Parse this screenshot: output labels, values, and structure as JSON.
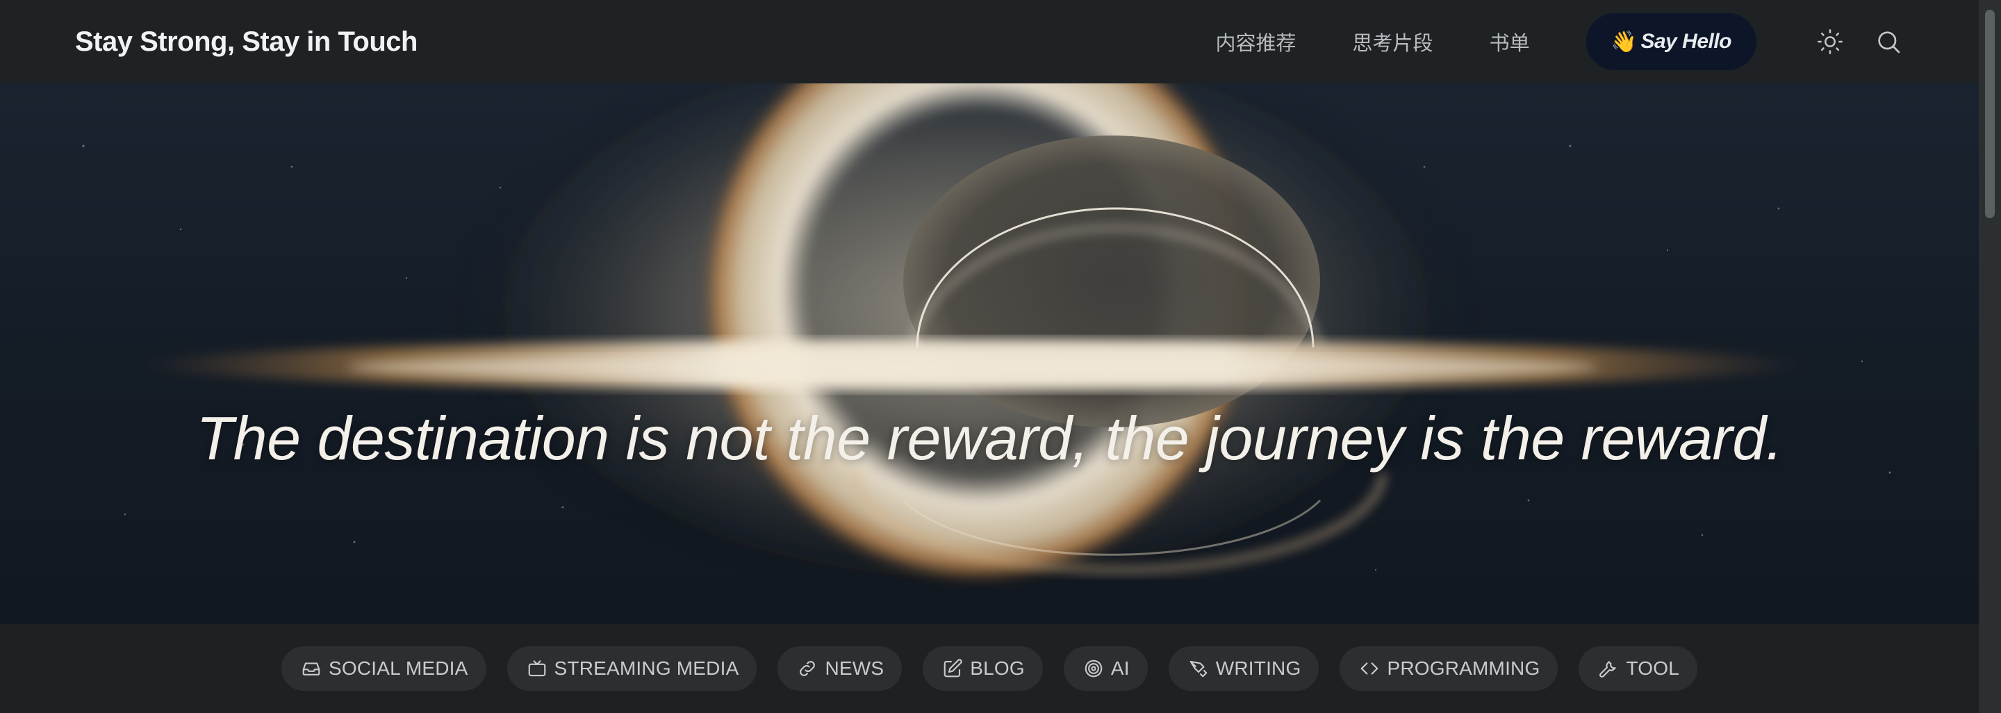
{
  "header": {
    "site_title": "Stay Strong, Stay in Touch",
    "nav": [
      {
        "label": "内容推荐"
      },
      {
        "label": "思考片段"
      },
      {
        "label": "书单"
      }
    ],
    "cta": {
      "emoji": "👋",
      "label": "Say Hello"
    },
    "icons": {
      "theme": "sun-icon",
      "search": "search-icon"
    }
  },
  "hero": {
    "quote": "The destination is not the reward, the journey is the reward."
  },
  "categories": [
    {
      "label": "SOCIAL MEDIA",
      "icon": "inbox-icon"
    },
    {
      "label": "STREAMING MEDIA",
      "icon": "tv-icon"
    },
    {
      "label": "NEWS",
      "icon": "link-icon"
    },
    {
      "label": "BLOG",
      "icon": "edit-icon"
    },
    {
      "label": "AI",
      "icon": "target-icon"
    },
    {
      "label": "WRITING",
      "icon": "pen-tool-icon"
    },
    {
      "label": "PROGRAMMING",
      "icon": "code-icon"
    },
    {
      "label": "TOOL",
      "icon": "wrench-icon"
    }
  ],
  "colors": {
    "header_bg": "#1e2224",
    "cta_bg": "#0d1628",
    "chip_bg": "#2b2f31",
    "accent_orange": "#e0a060"
  }
}
